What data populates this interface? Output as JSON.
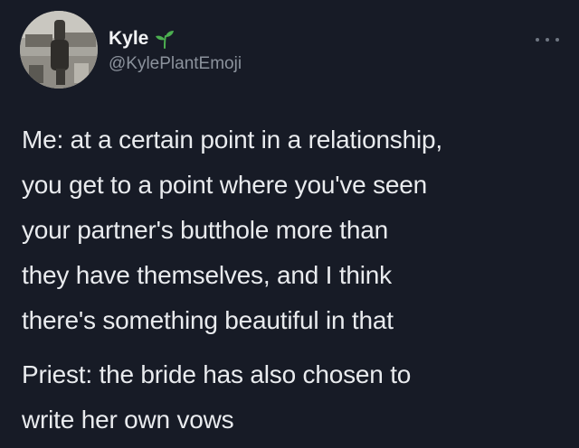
{
  "tweet": {
    "author": {
      "display_name": "Kyle",
      "handle": "@KylePlantEmoji",
      "badge_icon": "sprout-icon",
      "avatar_icon": "avatar-photo"
    },
    "menu_icon": "more-options-icon",
    "paragraphs": [
      "Me: at a certain point in a relationship,\nyou get to a point where you've seen\nyour partner's butthole more than\nthey have themselves, and I think\nthere's something beautiful in that",
      "Priest: the bride has also chosen to\nwrite her own vows"
    ]
  },
  "colors": {
    "background": "#171b26",
    "text": "#e9ebee",
    "handle": "#8b929c",
    "sprout": "#4caf50"
  }
}
